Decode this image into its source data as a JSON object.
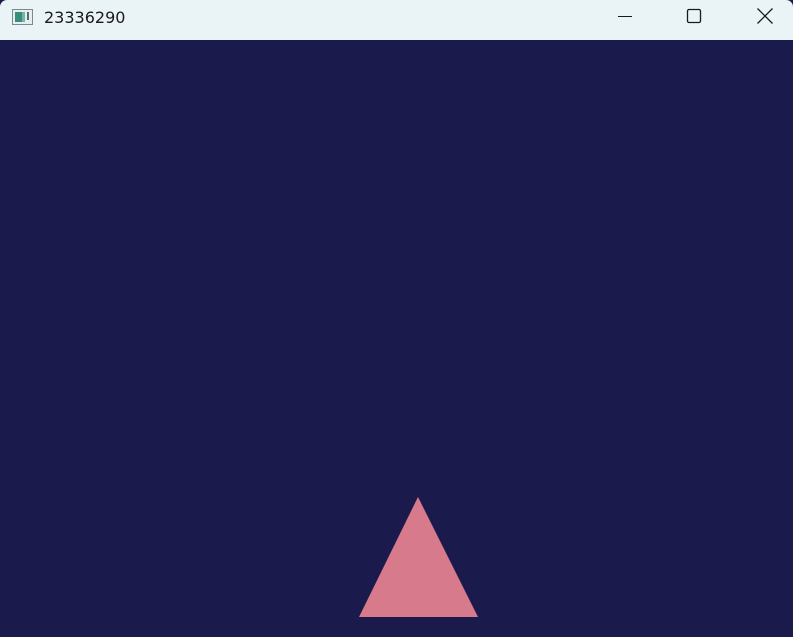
{
  "window": {
    "title": "23336290",
    "icon": "app-window-icon"
  },
  "controls": {
    "minimize_icon": "minimize-icon",
    "maximize_icon": "maximize-icon",
    "close_icon": "close-icon"
  },
  "scene": {
    "background_color": "#1b1a4c",
    "shape": "triangle",
    "shape_color": "#d67a8c"
  }
}
